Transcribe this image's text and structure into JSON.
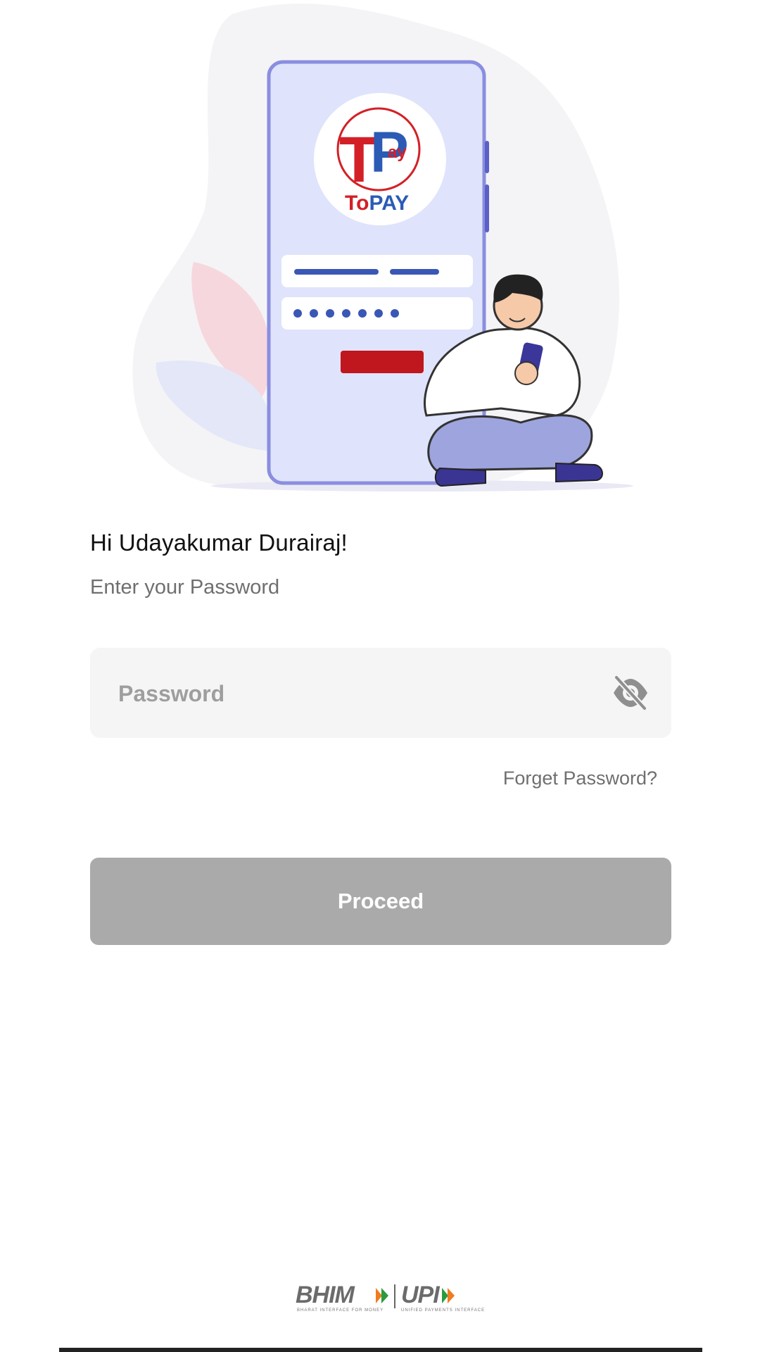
{
  "illustration": {
    "logo_letters": "TP",
    "logo_small": "ay",
    "logo_text_to": "To",
    "logo_text_pay": "PAY",
    "colors": {
      "red": "#d32027",
      "blue": "#2b5bb5",
      "phone": "#dfe3fb",
      "phone_border": "#8a8ee0"
    }
  },
  "greeting": "Hi Udayakumar Durairaj!",
  "subtitle": "Enter your Password",
  "password_field": {
    "placeholder": "Password",
    "value": "",
    "icon": "eye-off-icon"
  },
  "forget_password": "Forget Password?",
  "proceed_button": {
    "label": "Proceed",
    "color": "#aaaaaa"
  },
  "footer": {
    "bhim": "BHIM",
    "upi": "UPI",
    "bhim_tagline": "BHARAT INTERFACE FOR MONEY",
    "upi_tagline": "UNIFIED PAYMENTS INTERFACE"
  }
}
